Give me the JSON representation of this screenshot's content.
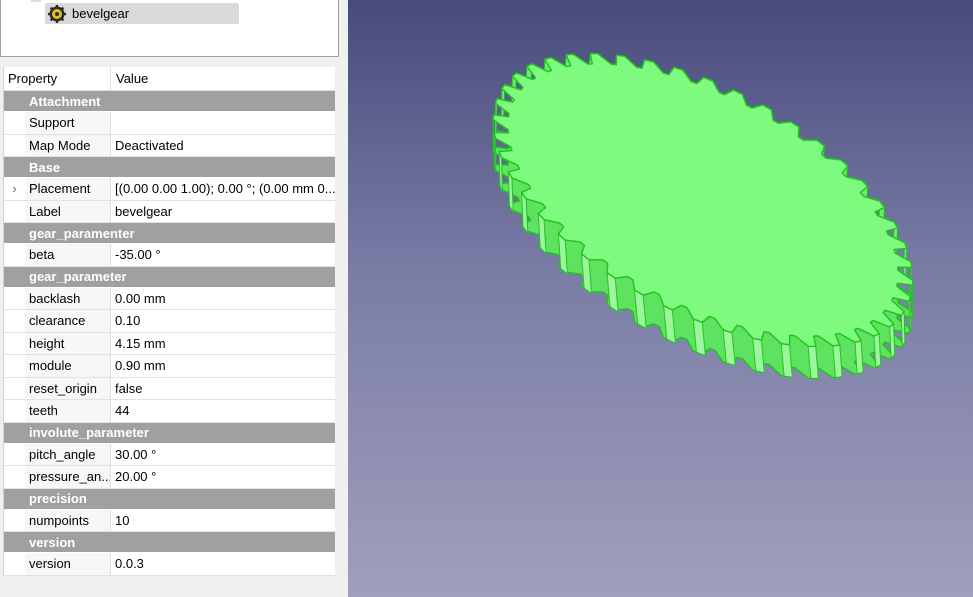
{
  "tree": {
    "item_label": "bevelgear",
    "item_icon": "gear-icon"
  },
  "property_editor": {
    "header": {
      "property": "Property",
      "value": "Value"
    },
    "groups": [
      {
        "name": "Attachment",
        "rows": [
          {
            "label": "Support",
            "value": ""
          },
          {
            "label": "Map Mode",
            "value": "Deactivated"
          }
        ]
      },
      {
        "name": "Base",
        "rows": [
          {
            "label": "Placement",
            "value": "[(0.00 0.00 1.00); 0.00 °; (0.00 mm  0....",
            "expandable": true
          },
          {
            "label": "Label",
            "value": "bevelgear"
          }
        ]
      },
      {
        "name": "gear_paramenter",
        "rows": [
          {
            "label": "beta",
            "value": "-35.00 °"
          }
        ]
      },
      {
        "name": "gear_parameter",
        "rows": [
          {
            "label": "backlash",
            "value": "0.00 mm"
          },
          {
            "label": "clearance",
            "value": "0.10"
          },
          {
            "label": "height",
            "value": "4.15 mm"
          },
          {
            "label": "module",
            "value": "0.90 mm"
          },
          {
            "label": "reset_origin",
            "value": "false"
          },
          {
            "label": "teeth",
            "value": "44"
          }
        ]
      },
      {
        "name": "involute_parameter",
        "rows": [
          {
            "label": "pitch_angle",
            "value": "30.00 °"
          },
          {
            "label": "pressure_an...",
            "value": "20.00 °"
          }
        ]
      },
      {
        "name": "precision",
        "rows": [
          {
            "label": "numpoints",
            "value": "10"
          }
        ]
      },
      {
        "name": "version",
        "rows": [
          {
            "label": "version",
            "value": "0.0.3"
          }
        ]
      }
    ]
  },
  "viewport": {
    "model_name": "bevelgear",
    "gear_teeth": 44,
    "colors": {
      "gear_fill": "#7efb7e",
      "gear_edge": "#22c422",
      "bg_top": "#484a7c",
      "bg_bottom": "#a09fbc"
    }
  }
}
